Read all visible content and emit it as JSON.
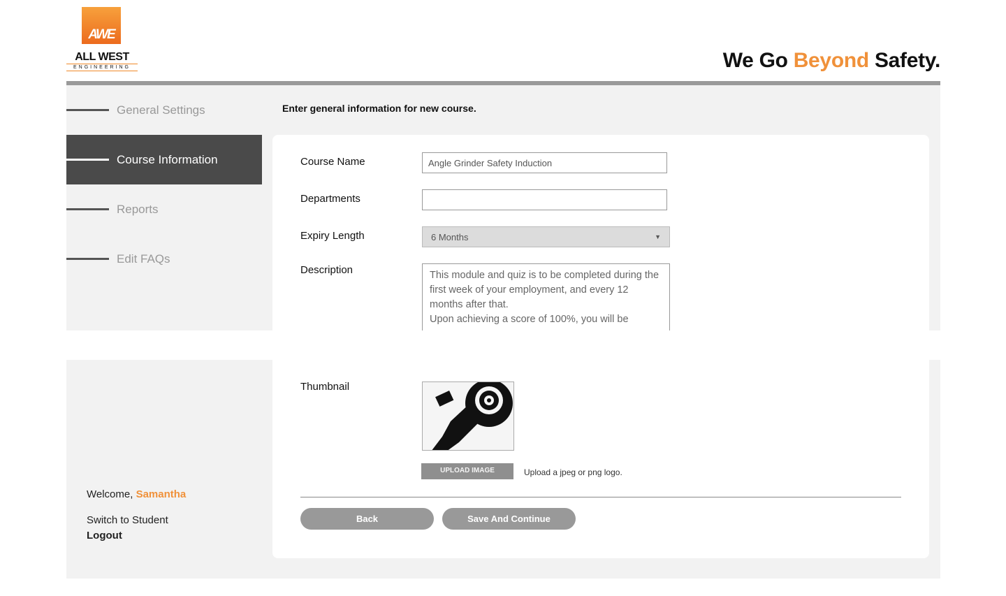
{
  "brand": {
    "logo_mark": "AWE",
    "logo_name": "ALL WEST",
    "logo_sub": "ENGINEERING",
    "tagline_prefix": "We Go ",
    "tagline_accent": "Beyond",
    "tagline_suffix": " Safety.",
    "accent_color": "#f0913a"
  },
  "sidebar": {
    "items": [
      {
        "label": "General Settings",
        "active": false
      },
      {
        "label": "Course Information",
        "active": true
      },
      {
        "label": "Reports",
        "active": false
      },
      {
        "label": "Edit FAQs",
        "active": false
      }
    ],
    "welcome_prefix": "Welcome, ",
    "user_name": "Samantha",
    "switch_label": "Switch to Student",
    "logout_label": "Logout"
  },
  "form": {
    "intro": "Enter general information for new course.",
    "course_name_label": "Course Name",
    "course_name_value": "Angle Grinder Safety Induction",
    "departments_label": "Departments",
    "departments_value": "",
    "expiry_label": "Expiry Length",
    "expiry_value": "6 Months",
    "description_label": "Description",
    "description_value": "This module and quiz is to be completed during the first week of your employment, and every 12 months after that.\nUpon achieving a score of 100%, you will be",
    "thumbnail_label": "Thumbnail",
    "thumbnail_icon": "angle-grinder-icon",
    "upload_label": "UPLOAD IMAGE",
    "upload_hint": "Upload a jpeg or png logo.",
    "back_label": "Back",
    "save_label": "Save And Continue"
  }
}
